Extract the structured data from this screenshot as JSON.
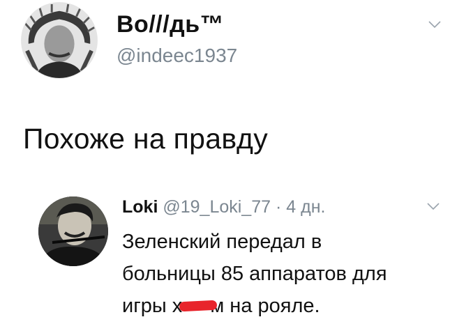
{
  "tweet": {
    "display_name": "Во///дь™",
    "handle": "@indeec1937",
    "text": "Похоже на правду",
    "avatar_icon": "profile-avatar-portrait-icon",
    "menu_icon": "chevron-down-icon"
  },
  "quoted_reply": {
    "name": "Loki",
    "handle": "@19_Loki_77",
    "separator": "·",
    "time": "4 дн.",
    "lines": [
      "Зеленский передал в",
      "больницы 85 аппаратов для",
      "игры х",
      "м на рояле."
    ],
    "censor_color": "#e8242b",
    "avatar_icon": "profile-avatar-photo-icon",
    "menu_icon": "chevron-down-icon"
  }
}
